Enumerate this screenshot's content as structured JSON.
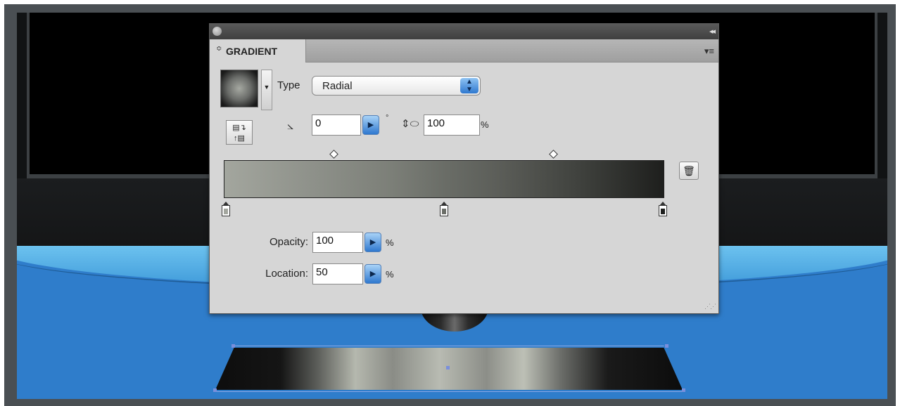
{
  "panel": {
    "tab_label": "GRADIENT",
    "tab_arrows": "≎",
    "collapse_glyph": "◂◂",
    "menu_glyph": "▾≡",
    "type_label": "Type",
    "type_value": "Radial",
    "angle_value": "0",
    "angle_unit": "°",
    "aspect_value": "100",
    "aspect_unit": "%",
    "opacity_label": "Opacity:",
    "opacity_value": "100",
    "opacity_unit": "%",
    "location_label": "Location:",
    "location_value": "50",
    "location_unit": "%"
  },
  "gradient_stops": [
    {
      "location": 0,
      "color": "#a3a69e"
    },
    {
      "location": 50,
      "color": "#6a6d67"
    },
    {
      "location": 100,
      "color": "#1e1f1d"
    }
  ],
  "gradient_midpoints": [
    25,
    75
  ],
  "colors": {
    "panel_bg": "#d6d6d6",
    "accent_blue": "#2f78cf",
    "stage_blue": "#2f7dcb"
  },
  "icons": {
    "close": "close-icon",
    "collapse": "collapse-icon",
    "menu": "panel-menu-icon",
    "reverse": "reverse-gradient-icon",
    "angle": "angle-icon",
    "aspect": "aspect-ratio-icon",
    "delete": "trash-icon"
  }
}
